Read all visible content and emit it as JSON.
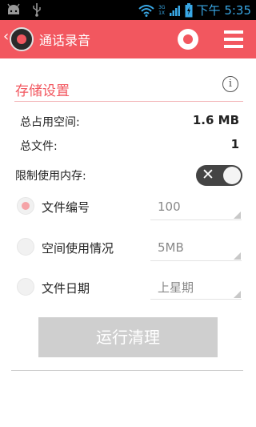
{
  "status_bar": {
    "time": "下午 5:35",
    "net_top": "3G",
    "net_bottom": "1X",
    "icons": [
      "android-icon",
      "usb-icon",
      "wifi-icon",
      "signal-icon",
      "battery-icon"
    ]
  },
  "app_bar": {
    "title": "通话录音",
    "background": "#f2575f"
  },
  "storage": {
    "section_title": "存储设置",
    "total_space_label": "总占用空间:",
    "total_space_value": "1.6 MB",
    "total_files_label": "总文件:",
    "total_files_value": "1"
  },
  "limit": {
    "label": "限制使用内存:",
    "enabled": false
  },
  "options": [
    {
      "label": "文件编号",
      "value": "100",
      "selected": true
    },
    {
      "label": "空间使用情况",
      "value": "5MB",
      "selected": false
    },
    {
      "label": "文件日期",
      "value": "上星期",
      "selected": false
    }
  ],
  "run_button": "运行清理",
  "colors": {
    "accent": "#f2575f",
    "run_button_disabled": "#cfcfcf"
  }
}
